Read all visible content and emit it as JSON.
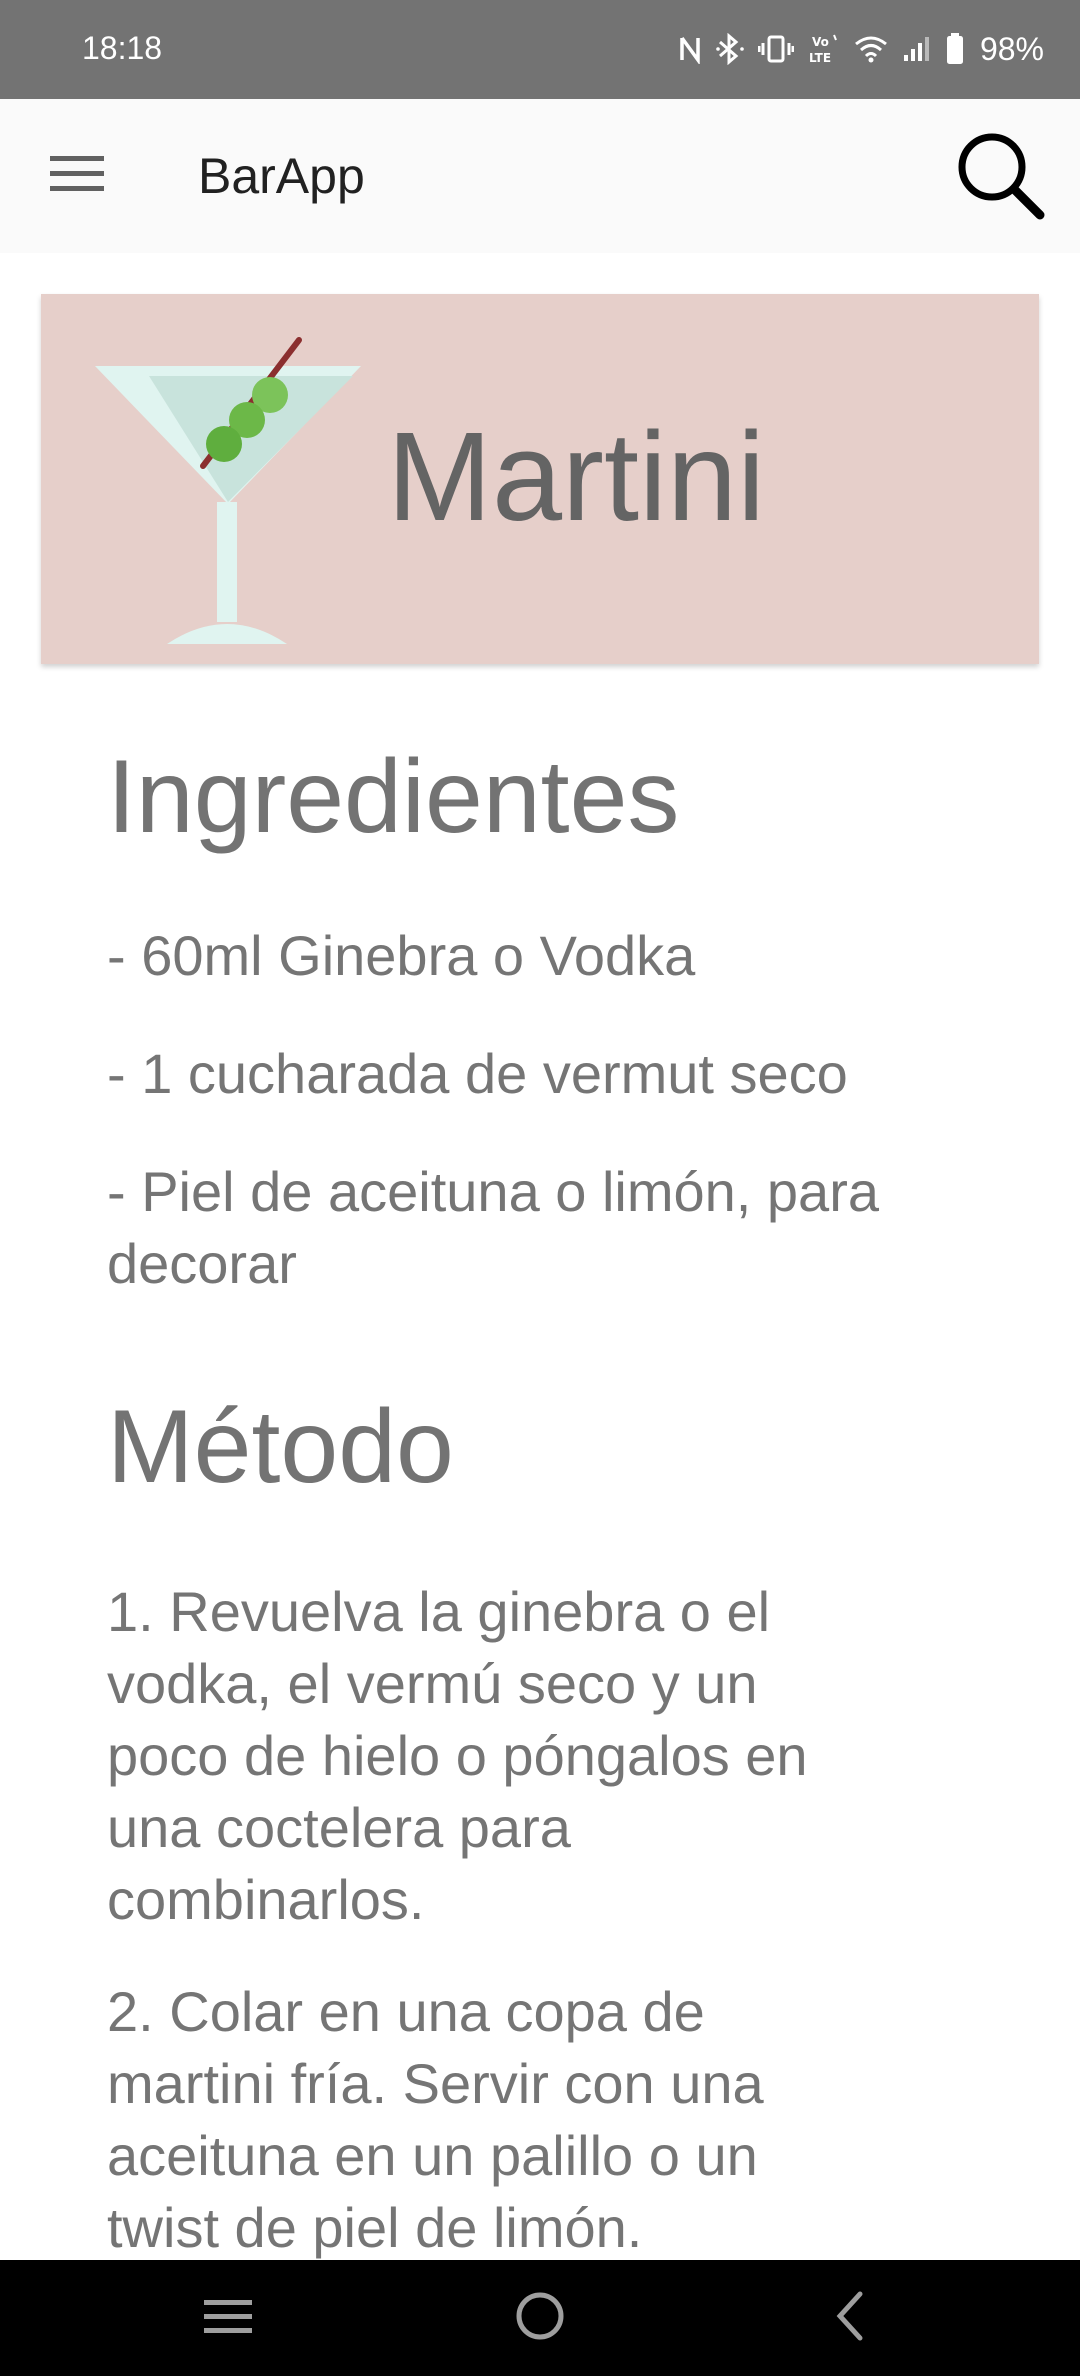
{
  "status_bar": {
    "time": "18:18",
    "battery": "98%",
    "icons": [
      "nfc-icon",
      "bluetooth-icon",
      "vibrate-icon",
      "volte-icon",
      "wifi-icon",
      "signal-icon",
      "battery-icon"
    ]
  },
  "app_bar": {
    "title": "BarApp",
    "menu_icon": "menu-icon",
    "search_icon": "search-icon"
  },
  "drink": {
    "name": "Martini",
    "icon": "martini-glass-icon",
    "card_color": "#e6cfca"
  },
  "ingredients": {
    "title": "Ingredientes",
    "items": [
      "- 60ml Ginebra o Vodka",
      "- 1 cucharada de vermut seco",
      "- Piel de aceituna o limón, para decorar"
    ]
  },
  "method": {
    "title": "Método",
    "steps": [
      "1. Revuelva la ginebra o el vodka, el vermú seco y un poco de hielo o póngalos en una coctelera para combinarlos.",
      "2. Colar en una copa de martini fría. Servir con una aceituna en un palillo o un twist de piel de limón."
    ]
  },
  "nav_bar": {
    "icons": [
      "recent-apps-icon",
      "home-icon",
      "back-icon"
    ]
  }
}
